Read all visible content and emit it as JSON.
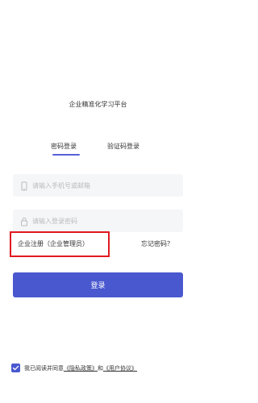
{
  "app": {
    "title": "企业精准化学习平台"
  },
  "tabs": [
    {
      "label": "密码登录",
      "active": true
    },
    {
      "label": "验证码登录",
      "active": false
    }
  ],
  "form": {
    "phone_placeholder": "请输入手机号或邮箱",
    "phone_value": "",
    "password_placeholder": "请输入登录密码",
    "password_value": ""
  },
  "links": {
    "register": "企业注册（企业管理员）",
    "forgot_password": "忘记密码？"
  },
  "login_button": "登录",
  "agreement": {
    "checked": true,
    "prefix": "我已阅读并同意",
    "privacy_link": "《隐私政策》",
    "conjunction": "和",
    "terms_link": "《用户协议》"
  },
  "colors": {
    "accent": "#4A58CF",
    "highlight": "#E0191F",
    "field_background": "#F5F6F8"
  },
  "icons": {
    "phone_field": "phone-icon",
    "password_field": "lock-icon",
    "agreement_checkbox": "checkmark-icon"
  }
}
